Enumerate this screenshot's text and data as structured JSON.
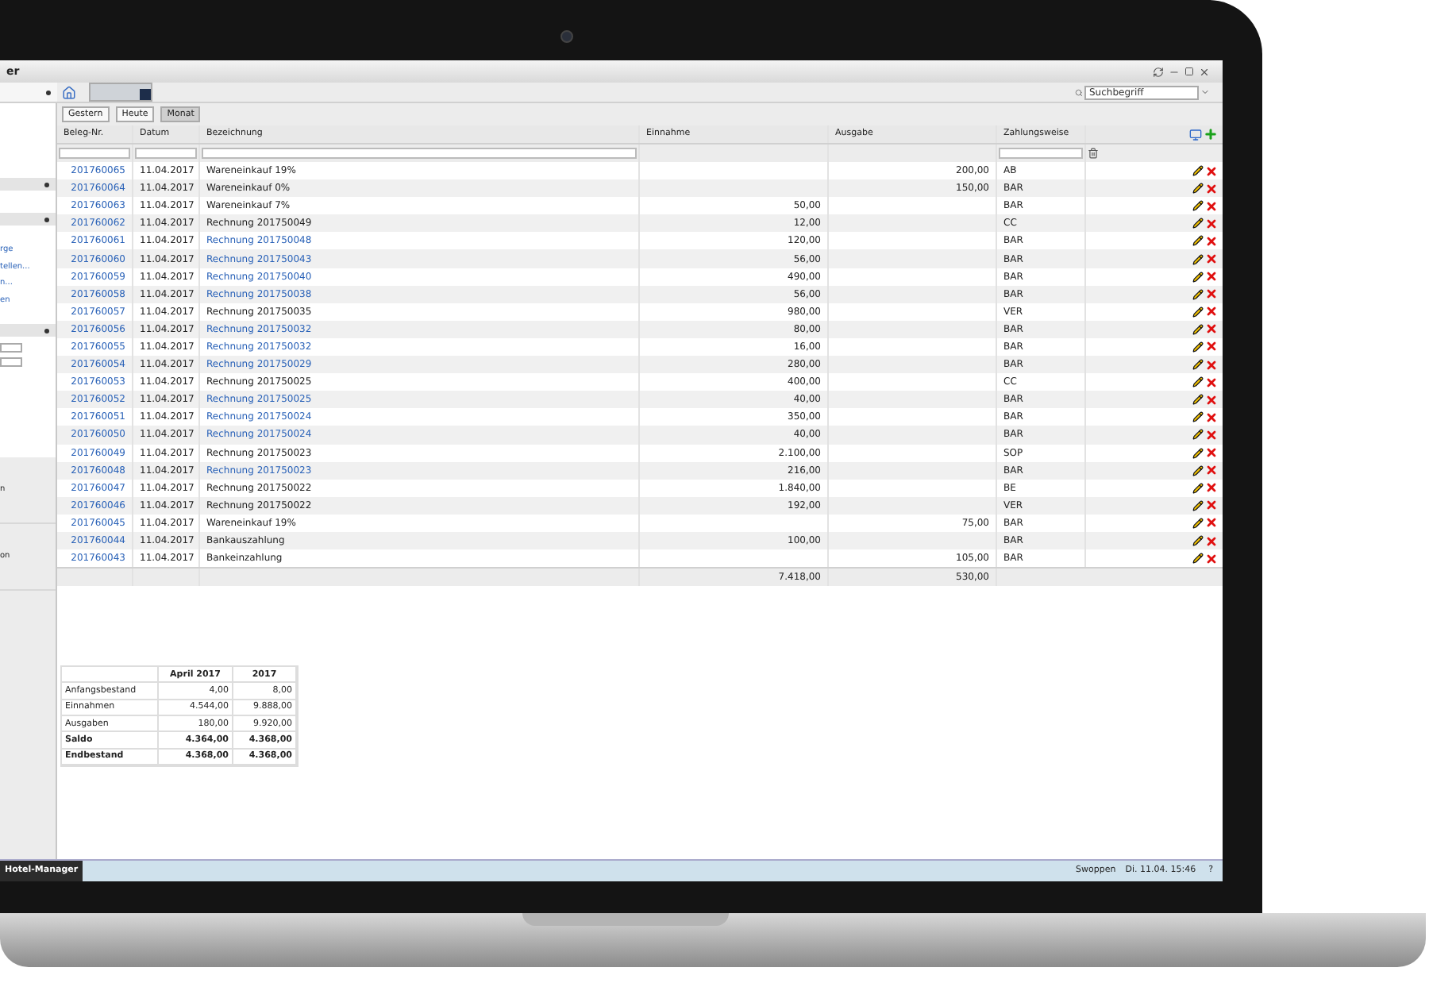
{
  "window": {
    "title": "er"
  },
  "search": {
    "placeholder": "Suchbegriff"
  },
  "sidebar": {
    "links": [
      "rge",
      "tellen...",
      "n...",
      "en"
    ],
    "lower_items": [
      "n",
      "on"
    ]
  },
  "period_buttons": [
    {
      "label": "Gestern",
      "selected": false
    },
    {
      "label": "Heute",
      "selected": false
    },
    {
      "label": "Monat",
      "selected": true
    }
  ],
  "table": {
    "columns": [
      "Beleg-Nr.",
      "Datum",
      "Bezeichnung",
      "Einnahme",
      "Ausgabe",
      "Zahlungsweise"
    ],
    "rows": [
      {
        "nr": "201760065",
        "datum": "11.04.2017",
        "bezeichnung": "Wareneinkauf 19%",
        "link": false,
        "einnahme": "",
        "ausgabe": "200,00",
        "zahlungsweise": "AB"
      },
      {
        "nr": "201760064",
        "datum": "11.04.2017",
        "bezeichnung": "Wareneinkauf 0%",
        "link": false,
        "einnahme": "",
        "ausgabe": "150,00",
        "zahlungsweise": "BAR"
      },
      {
        "nr": "201760063",
        "datum": "11.04.2017",
        "bezeichnung": "Wareneinkauf 7%",
        "link": false,
        "einnahme": "50,00",
        "ausgabe": "",
        "zahlungsweise": "BAR"
      },
      {
        "nr": "201760062",
        "datum": "11.04.2017",
        "bezeichnung": "Rechnung 201750049",
        "link": false,
        "einnahme": "12,00",
        "ausgabe": "",
        "zahlungsweise": "CC"
      },
      {
        "nr": "201760061",
        "datum": "11.04.2017",
        "bezeichnung": "Rechnung 201750048",
        "link": true,
        "einnahme": "120,00",
        "ausgabe": "",
        "zahlungsweise": "BAR"
      },
      {
        "nr": "201760060",
        "datum": "11.04.2017",
        "bezeichnung": "Rechnung 201750043",
        "link": true,
        "einnahme": "56,00",
        "ausgabe": "",
        "zahlungsweise": "BAR"
      },
      {
        "nr": "201760059",
        "datum": "11.04.2017",
        "bezeichnung": "Rechnung 201750040",
        "link": true,
        "einnahme": "490,00",
        "ausgabe": "",
        "zahlungsweise": "BAR"
      },
      {
        "nr": "201760058",
        "datum": "11.04.2017",
        "bezeichnung": "Rechnung 201750038",
        "link": true,
        "einnahme": "56,00",
        "ausgabe": "",
        "zahlungsweise": "BAR"
      },
      {
        "nr": "201760057",
        "datum": "11.04.2017",
        "bezeichnung": "Rechnung 201750035",
        "link": false,
        "einnahme": "980,00",
        "ausgabe": "",
        "zahlungsweise": "VER"
      },
      {
        "nr": "201760056",
        "datum": "11.04.2017",
        "bezeichnung": "Rechnung 201750032",
        "link": true,
        "einnahme": "80,00",
        "ausgabe": "",
        "zahlungsweise": "BAR"
      },
      {
        "nr": "201760055",
        "datum": "11.04.2017",
        "bezeichnung": "Rechnung 201750032",
        "link": true,
        "einnahme": "16,00",
        "ausgabe": "",
        "zahlungsweise": "BAR"
      },
      {
        "nr": "201760054",
        "datum": "11.04.2017",
        "bezeichnung": "Rechnung 201750029",
        "link": true,
        "einnahme": "280,00",
        "ausgabe": "",
        "zahlungsweise": "BAR"
      },
      {
        "nr": "201760053",
        "datum": "11.04.2017",
        "bezeichnung": "Rechnung 201750025",
        "link": false,
        "einnahme": "400,00",
        "ausgabe": "",
        "zahlungsweise": "CC"
      },
      {
        "nr": "201760052",
        "datum": "11.04.2017",
        "bezeichnung": "Rechnung 201750025",
        "link": true,
        "einnahme": "40,00",
        "ausgabe": "",
        "zahlungsweise": "BAR"
      },
      {
        "nr": "201760051",
        "datum": "11.04.2017",
        "bezeichnung": "Rechnung 201750024",
        "link": true,
        "einnahme": "350,00",
        "ausgabe": "",
        "zahlungsweise": "BAR"
      },
      {
        "nr": "201760050",
        "datum": "11.04.2017",
        "bezeichnung": "Rechnung 201750024",
        "link": true,
        "einnahme": "40,00",
        "ausgabe": "",
        "zahlungsweise": "BAR"
      },
      {
        "nr": "201760049",
        "datum": "11.04.2017",
        "bezeichnung": "Rechnung 201750023",
        "link": false,
        "einnahme": "2.100,00",
        "ausgabe": "",
        "zahlungsweise": "SOP"
      },
      {
        "nr": "201760048",
        "datum": "11.04.2017",
        "bezeichnung": "Rechnung 201750023",
        "link": true,
        "einnahme": "216,00",
        "ausgabe": "",
        "zahlungsweise": "BAR"
      },
      {
        "nr": "201760047",
        "datum": "11.04.2017",
        "bezeichnung": "Rechnung 201750022",
        "link": false,
        "einnahme": "1.840,00",
        "ausgabe": "",
        "zahlungsweise": "BE"
      },
      {
        "nr": "201760046",
        "datum": "11.04.2017",
        "bezeichnung": "Rechnung 201750022",
        "link": false,
        "einnahme": "192,00",
        "ausgabe": "",
        "zahlungsweise": "VER"
      },
      {
        "nr": "201760045",
        "datum": "11.04.2017",
        "bezeichnung": "Wareneinkauf 19%",
        "link": false,
        "einnahme": "",
        "ausgabe": "75,00",
        "zahlungsweise": "BAR"
      },
      {
        "nr": "201760044",
        "datum": "11.04.2017",
        "bezeichnung": "Bankauszahlung",
        "link": false,
        "einnahme": "100,00",
        "ausgabe": "",
        "zahlungsweise": "BAR"
      },
      {
        "nr": "201760043",
        "datum": "11.04.2017",
        "bezeichnung": "Bankeinzahlung",
        "link": false,
        "einnahme": "",
        "ausgabe": "105,00",
        "zahlungsweise": "BAR"
      }
    ],
    "totals": {
      "einnahme": "7.418,00",
      "ausgabe": "530,00"
    }
  },
  "summary": {
    "columns": [
      "April 2017",
      "2017"
    ],
    "rows": [
      {
        "label": "Anfangsbestand",
        "bold": false,
        "values": [
          "4,00",
          "8,00"
        ]
      },
      {
        "label": "Einnahmen",
        "bold": false,
        "values": [
          "4.544,00",
          "9.888,00"
        ]
      },
      {
        "label": "Ausgaben",
        "bold": false,
        "values": [
          "180,00",
          "9.920,00"
        ]
      },
      {
        "label": "Saldo",
        "bold": true,
        "values": [
          "4.364,00",
          "4.368,00"
        ]
      },
      {
        "label": "Endbestand",
        "bold": true,
        "values": [
          "4.368,00",
          "4.368,00"
        ]
      }
    ]
  },
  "taskbar": {
    "tasks": [
      {
        "label": "Hotel-Manager",
        "selected": true
      }
    ],
    "user": "Swoppen",
    "datetime": "Di. 11.04. 15:46",
    "help": "?"
  }
}
